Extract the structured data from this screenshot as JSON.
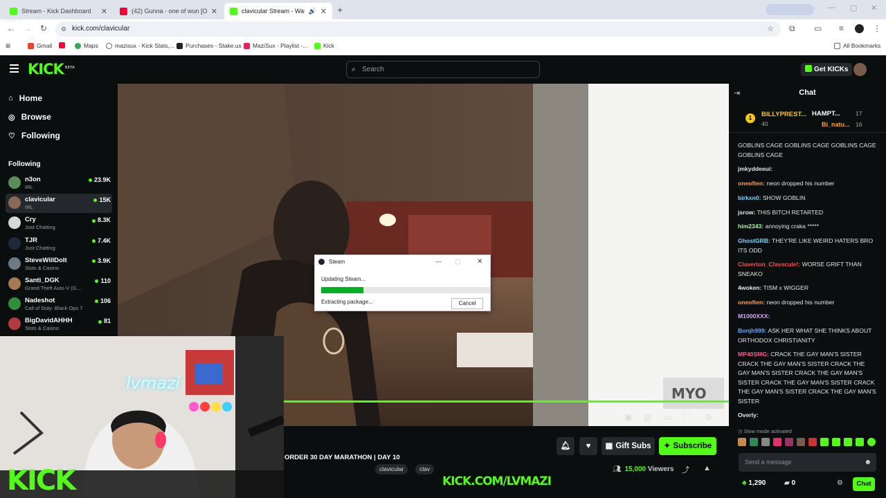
{
  "browser": {
    "tabs": [
      {
        "title": "Stream - Kick Dashboard",
        "active": false
      },
      {
        "title": "(42) Gunna - one of wun [Offici...",
        "active": false
      },
      {
        "title": "clavicular Stream - Watch L...",
        "active": true
      }
    ],
    "url": "kick.com/clavicular",
    "bookmarks": [
      "Gmail",
      "Maps",
      "mazisux - Kick Stats,...",
      "Purchases - Stake.us",
      "MaziSux - Playlist -...",
      "Kick"
    ],
    "all_bookmarks": "All Bookmarks"
  },
  "header": {
    "logo": "KICK",
    "logo_badge": "BETA",
    "search_placeholder": "Search",
    "get_kicks": "Get KICKs"
  },
  "sidebar": {
    "nav": [
      {
        "label": "Home",
        "icon": "home-icon"
      },
      {
        "label": "Browse",
        "icon": "compass-icon"
      },
      {
        "label": "Following",
        "icon": "heart-icon"
      }
    ],
    "following_title": "Following",
    "channels": [
      {
        "name": "n3on",
        "category": "IRL",
        "viewers": "23.9K",
        "color": "#5b8c5a"
      },
      {
        "name": "clavicular",
        "category": "IRL",
        "viewers": "15K",
        "color": "#8a6a55",
        "selected": true
      },
      {
        "name": "Cry",
        "category": "Just Chatting",
        "viewers": "8.3K",
        "color": "#d9d9d9"
      },
      {
        "name": "TJR",
        "category": "Just Chatting",
        "viewers": "7.4K",
        "color": "#1e2a3a"
      },
      {
        "name": "SteveWillDoIt",
        "category": "Slots & Casino",
        "viewers": "3.9K",
        "color": "#6c7a86"
      },
      {
        "name": "Santi_DGK",
        "category": "Grand Theft Auto V (G...",
        "viewers": "110",
        "color": "#a37a52"
      },
      {
        "name": "Nadeshot",
        "category": "Call of Duty: Black Ops 7",
        "viewers": "106",
        "color": "#2f8f3a"
      },
      {
        "name": "BigDavidAHHH",
        "category": "Slots & Casino",
        "viewers": "81",
        "color": "#b33b3b"
      }
    ]
  },
  "steam_dialog": {
    "title": "Steam",
    "status": "Updating Steam...",
    "detail": "Extracting package...",
    "progress": 0.25,
    "cancel": "Cancel"
  },
  "cam_overlay": {
    "neon_text": "lvmazi",
    "kick_logo": "KICK",
    "url_text": "KICK.COM/LVMAZI"
  },
  "stream": {
    "title": "ORDER 30 DAY MARATHON | DAY 10",
    "tags": [
      "clavicular",
      "clav"
    ],
    "viewers": "15,000",
    "viewers_label": "Viewers",
    "gift_subs": "Gift Subs",
    "subscribe": "Subscribe"
  },
  "chat": {
    "title": "Chat",
    "leaderboard": [
      {
        "rank": "1",
        "name": "BILLYPREST...",
        "count": "40"
      },
      {
        "name": "HAMPT...",
        "count": "17"
      },
      {
        "name": "Bi_natu...",
        "count": "16"
      }
    ],
    "messages": [
      {
        "user": "",
        "text": "GOBLINS CAGE GOBLINS CAGE GOBLINS CAGE GOBLINS CAGE",
        "color": "#e5e5e5"
      },
      {
        "user": "jmkyddeeui:",
        "text": "",
        "color": "#e5e5e5"
      },
      {
        "user": "oneoften:",
        "text": " neon dropped his number",
        "color": "#ff9b45"
      },
      {
        "user": "birkxn0:",
        "text": " SHOW GOBLIN",
        "color": "#7ad7ff"
      },
      {
        "user": "jsrow:",
        "text": " THIS BITCH RETARTED",
        "color": "#e5e5e5"
      },
      {
        "user": "him2343:",
        "text": " annoying craka *****",
        "color": "#b0f0b0"
      },
      {
        "user": "GhostGRB:",
        "text": " THEY'RE LIKE WEIRD HATERS BRO ITS ODD",
        "color": "#7ad7ff"
      },
      {
        "user": "Claverton_Clavscule!:",
        "text": " WORSE GRIFT THAN SNEAKO",
        "color": "#ff4d4d"
      },
      {
        "user": "4woken:",
        "text": " TISM x WIGGER",
        "color": "#e5e5e5"
      },
      {
        "user": "oneoften:",
        "text": " neon dropped his number",
        "color": "#ff9b45"
      },
      {
        "user": "M1000XXX:",
        "text": "",
        "color": "#d8a8ff"
      },
      {
        "user": "Bonjh999:",
        "text": " ASK HER WHAT SHE THINKS ABOUT ORTHODOX CHRISTIANITY",
        "color": "#6aa8ff"
      },
      {
        "user": "MP40SMG:",
        "text": " CRACK THE GAY MAN'S SISTER CRACK THE GAY MAN'S SISTER CRACK THE GAY MAN'S SISTER CRACK THE GAY MAN'S SISTER CRACK THE GAY MAN'S SISTER CRACK THE GAY MAN'S SISTER CRACK THE GAY MAN'S SISTER",
        "color": "#ff5a8a"
      },
      {
        "user": "Overly:",
        "text": "",
        "color": "#e5e5e5"
      }
    ],
    "slow_mode": "Slow mode activated",
    "input_placeholder": "Send a message",
    "points": "1,290",
    "other_count": "0",
    "send_label": "Chat"
  }
}
